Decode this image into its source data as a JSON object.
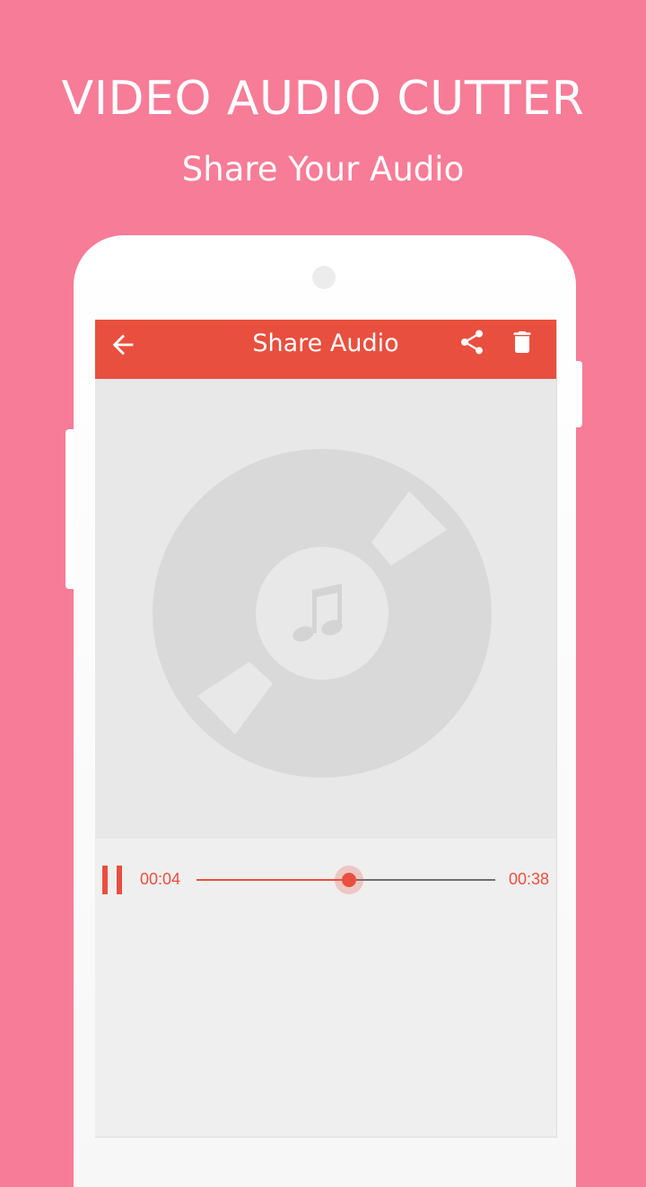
{
  "promo": {
    "title": "VIDEO AUDIO CUTTER",
    "subtitle": "Share Your Audio"
  },
  "app_bar": {
    "title": "Share Audio",
    "back_icon": "arrow-back-icon",
    "share_icon": "share-icon",
    "delete_icon": "trash-icon"
  },
  "album_art": {
    "icon": "music-note-icon"
  },
  "player": {
    "state_icon": "pause-icon",
    "current_time": "00:04",
    "total_time": "00:38",
    "progress": 0.51
  },
  "colors": {
    "background": "#f77c97",
    "accent": "#e84f3e",
    "disc": "#d9d9d9",
    "art_background": "#e8e8e8"
  }
}
